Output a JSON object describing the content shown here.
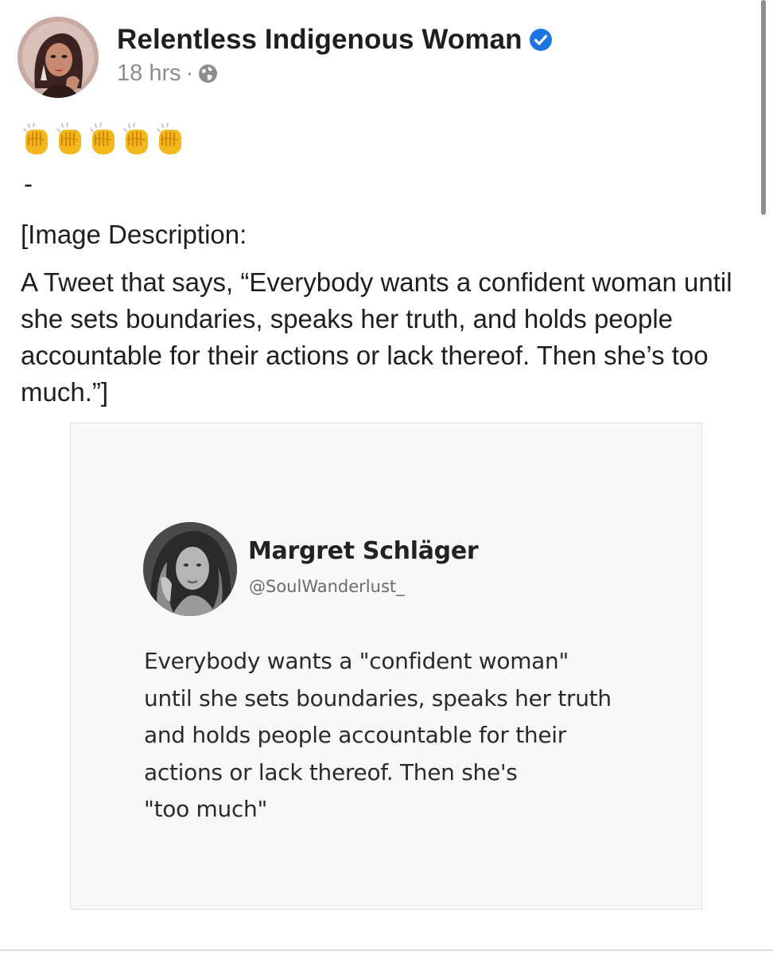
{
  "post": {
    "author": "Relentless Indigenous Woman",
    "verified": true,
    "time": "18 hrs",
    "meta_separator": "·",
    "audience_icon": "globe-icon",
    "emoji": [
      "👏",
      "👏",
      "👏",
      "👏",
      "👏"
    ],
    "separator_text": "-",
    "description_heading": "[Image Description:",
    "description_body": "A Tweet that says, “Everybody wants a confident woman until she sets boundaries, speaks her truth, and holds people accountable for their actions or lack thereof. Then she’s too much.”]"
  },
  "tweet": {
    "name": "Margret Schläger",
    "handle": "@SoulWanderlust_",
    "lines": [
      "Everybody wants a \"confident woman\"",
      "until she sets boundaries, speaks her truth",
      "and holds people accountable for their",
      "actions or lack thereof. Then she's",
      "\"too much\""
    ]
  },
  "colors": {
    "verified_blue": "#1b74e4",
    "meta_gray": "#8a8d91",
    "text": "#1c1e21",
    "card_bg": "#f8f8f8"
  }
}
